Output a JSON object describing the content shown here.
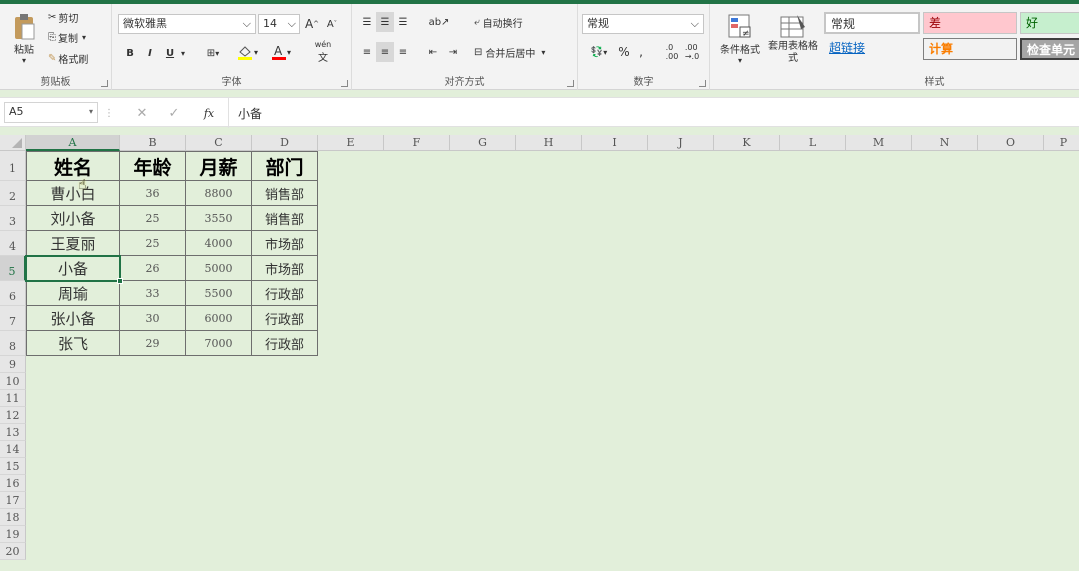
{
  "clipboard": {
    "paste": "粘贴",
    "cut": "剪切",
    "copy": "复制",
    "format_painter": "格式刷",
    "label": "剪贴板"
  },
  "font": {
    "name": "微软雅黑",
    "size": "14",
    "bold": "B",
    "italic": "I",
    "underline": "U",
    "label": "字体",
    "grow": "A",
    "shrink": "A",
    "wen": "wén"
  },
  "align": {
    "wrap": "自动换行",
    "merge": "合并后居中",
    "label": "对齐方式"
  },
  "number": {
    "format": "常规",
    "percent": "%",
    "comma": ",",
    "inc": "←.0 .00",
    "dec": ".00 →.0",
    "label": "数字"
  },
  "styles": {
    "conditional": "条件格式",
    "table_format": "套用表格格式",
    "label": "样式",
    "cells": [
      {
        "text": "常规",
        "bg": "#ffffff",
        "color": "#000000"
      },
      {
        "text": "差",
        "bg": "#ffc7ce",
        "color": "#9c0006"
      },
      {
        "text": "好",
        "bg": "#c6efce",
        "color": "#006100"
      },
      {
        "text": "超链接",
        "bg": "#f3f3f3",
        "color": "#0563c1"
      },
      {
        "text": "计算",
        "bg": "#f2f2f2",
        "color": "#fa7d00"
      },
      {
        "text": "检查单元",
        "bg": "#a5a5a5",
        "color": "#ffffff"
      }
    ]
  },
  "formula_bar": {
    "name_box": "A5",
    "fx": "fx",
    "value": "小备"
  },
  "columns": [
    "A",
    "B",
    "C",
    "D",
    "E",
    "F",
    "G",
    "H",
    "I",
    "J",
    "K",
    "L",
    "M",
    "N",
    "O",
    "P"
  ],
  "rows": [
    "1",
    "2",
    "3",
    "4",
    "5",
    "6",
    "7",
    "8",
    "9",
    "10",
    "11",
    "12",
    "13",
    "14",
    "15",
    "16",
    "17",
    "18",
    "19",
    "20"
  ],
  "table": {
    "headers": [
      "姓名",
      "年龄",
      "月薪",
      "部门"
    ],
    "data": [
      [
        "曹小白",
        "36",
        "8800",
        "销售部"
      ],
      [
        "刘小备",
        "25",
        "3550",
        "销售部"
      ],
      [
        "王夏丽",
        "25",
        "4000",
        "市场部"
      ],
      [
        "小备",
        "26",
        "5000",
        "市场部"
      ],
      [
        "周瑜",
        "33",
        "5500",
        "行政部"
      ],
      [
        "张小备",
        "30",
        "6000",
        "行政部"
      ],
      [
        "张飞",
        "29",
        "7000",
        "行政部"
      ]
    ]
  },
  "colors": {
    "accent": "#217346",
    "sheet_bg": "#e2efda",
    "selected_border": "#217346"
  }
}
